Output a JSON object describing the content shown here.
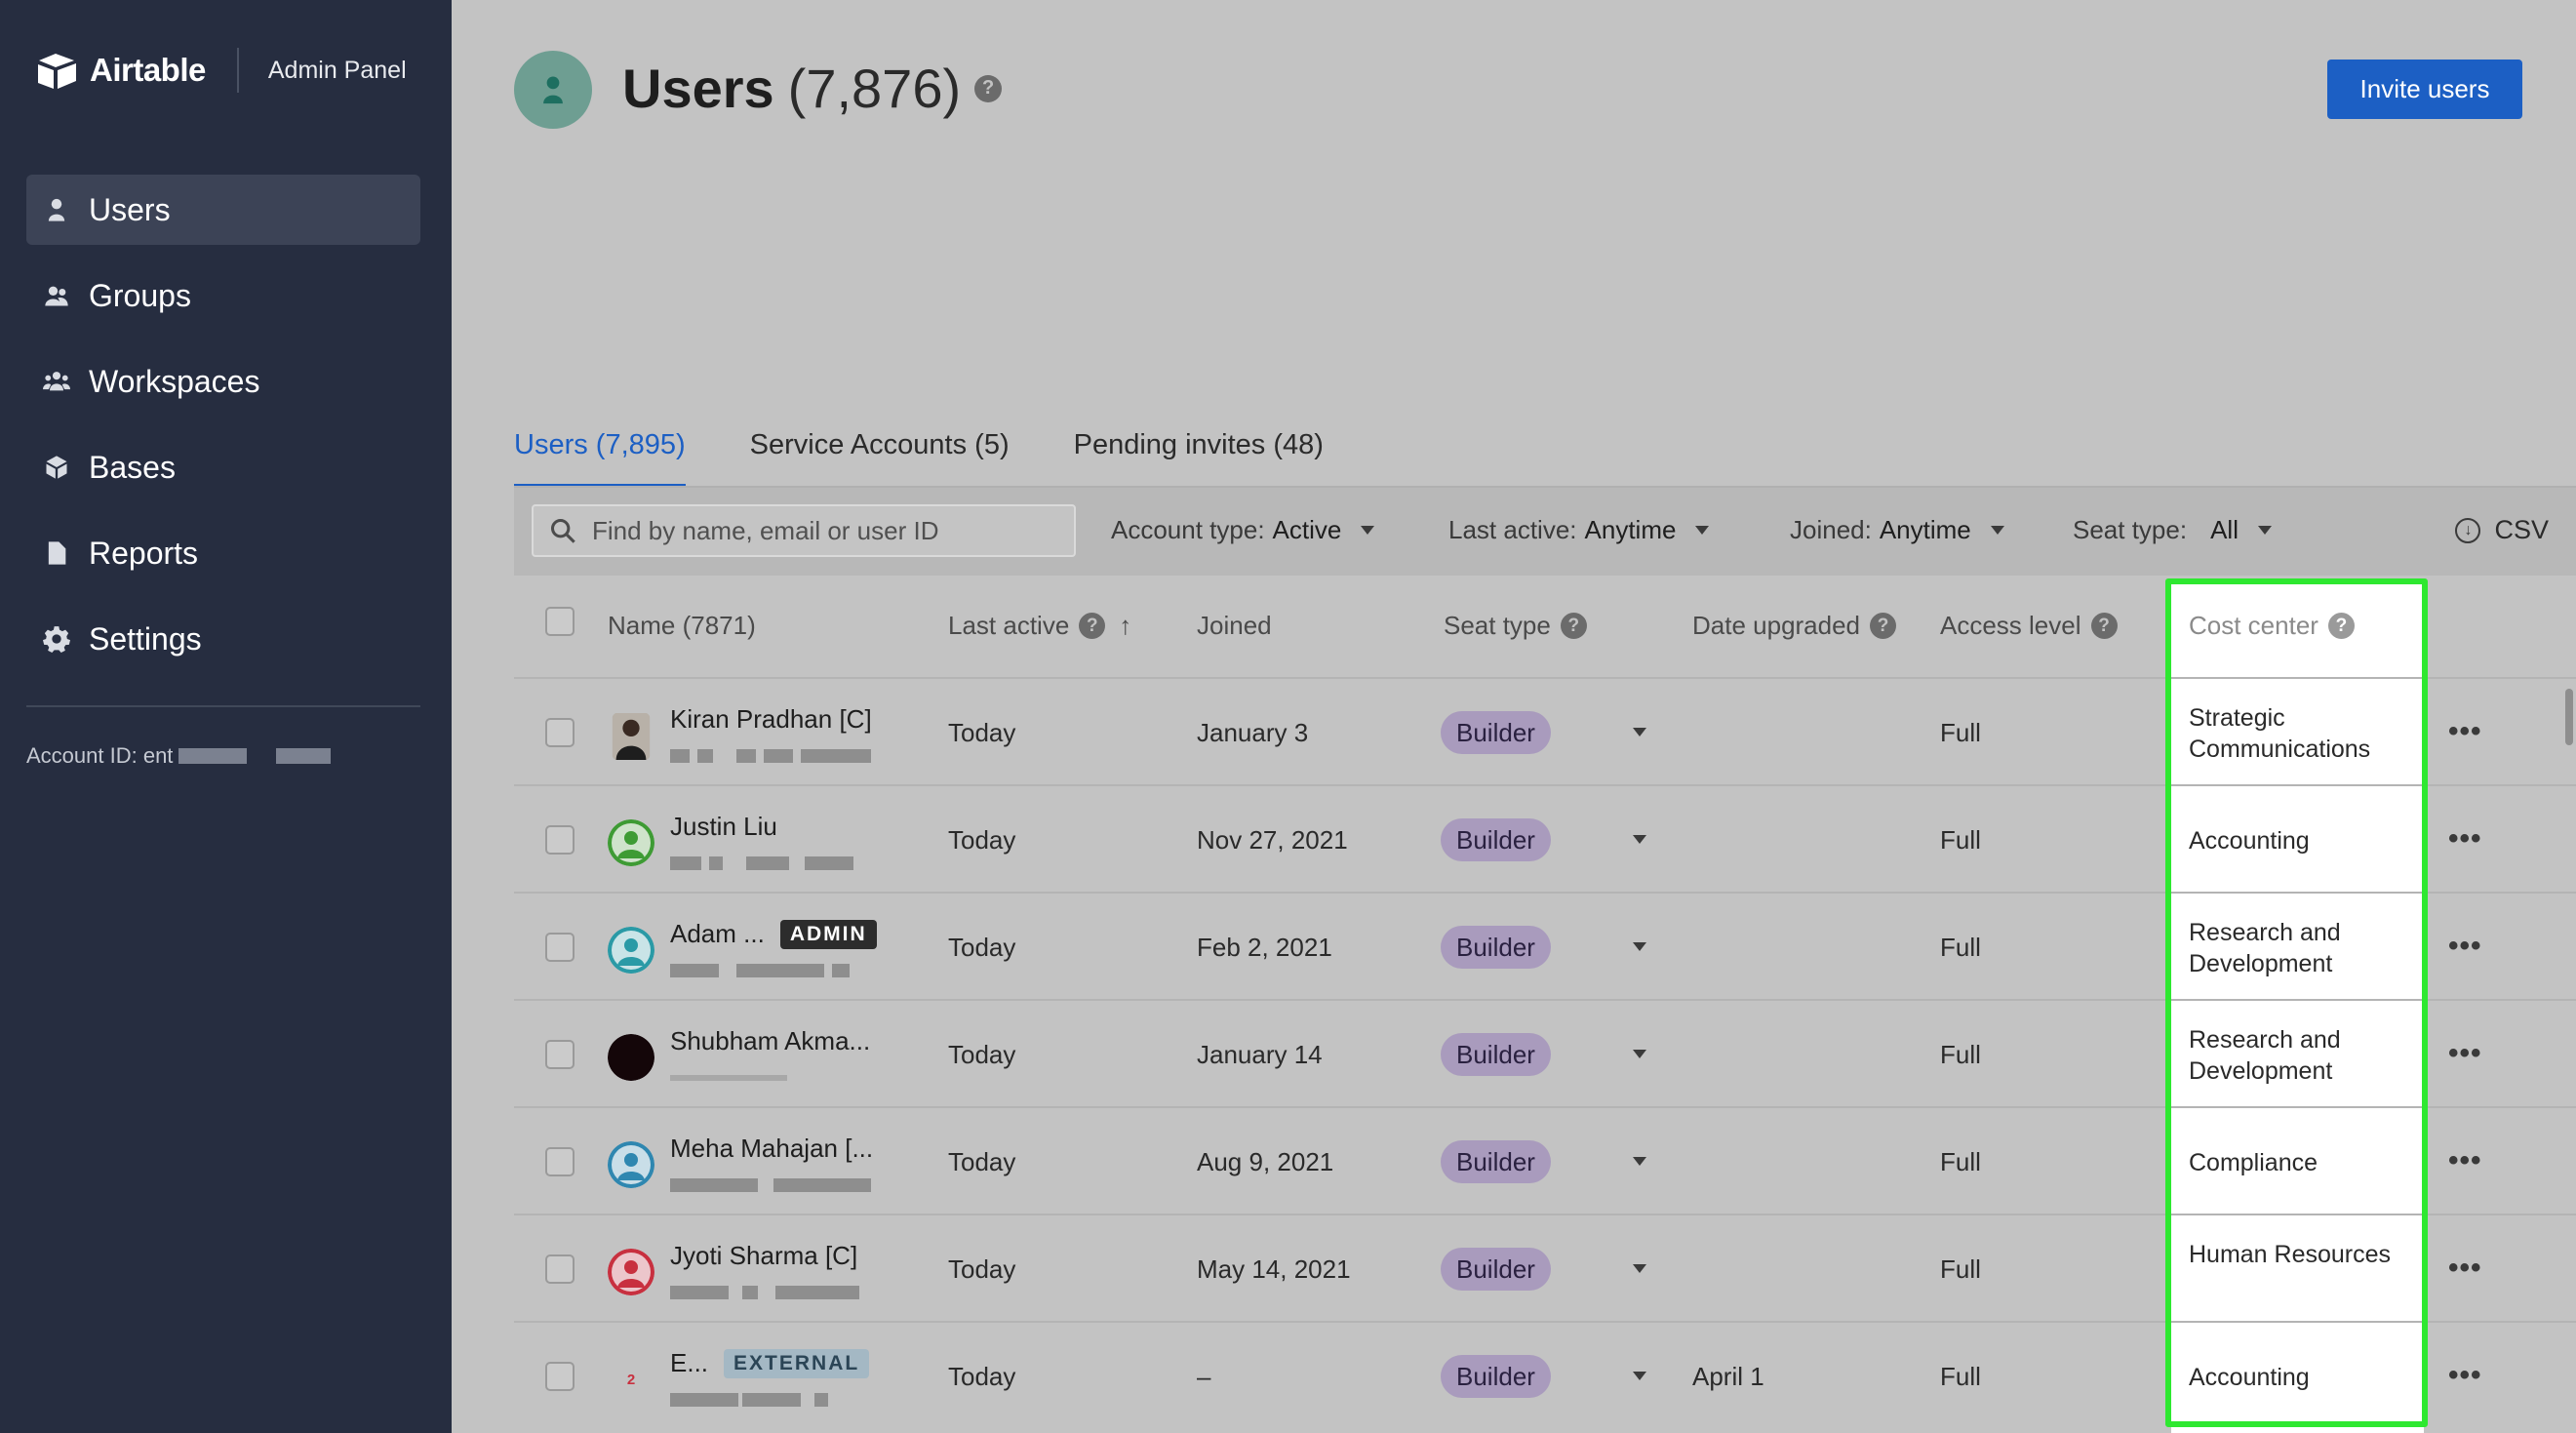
{
  "sidebar": {
    "brand": "Airtable",
    "panel": "Admin Panel",
    "items": [
      {
        "label": "Users",
        "icon": "user-icon",
        "active": true
      },
      {
        "label": "Groups",
        "icon": "group-icon"
      },
      {
        "label": "Workspaces",
        "icon": "workspaces-icon"
      },
      {
        "label": "Bases",
        "icon": "cube-icon"
      },
      {
        "label": "Reports",
        "icon": "document-icon"
      },
      {
        "label": "Settings",
        "icon": "gear-icon"
      }
    ],
    "account_id_label": "Account ID: ent"
  },
  "header": {
    "title": "Users",
    "count": "(7,876)",
    "help": "?",
    "invite_label": "Invite users"
  },
  "tabs": [
    {
      "label": "Users (7,895)",
      "active": true
    },
    {
      "label": "Service Accounts (5)"
    },
    {
      "label": "Pending invites (48)"
    }
  ],
  "filters": {
    "search_placeholder": "Find by name, email or user ID",
    "account_type": {
      "label": "Account type:",
      "value": "Active"
    },
    "last_active": {
      "label": "Last active:",
      "value": "Anytime"
    },
    "joined": {
      "label": "Joined:",
      "value": "Anytime"
    },
    "seat_type": {
      "label": "Seat type:",
      "value": "All"
    },
    "csv_label": "CSV"
  },
  "table": {
    "columns": {
      "name": "Name (7871)",
      "last_active": "Last active",
      "joined": "Joined",
      "seat_type": "Seat type",
      "date_upgraded": "Date upgraded",
      "access_level": "Access level",
      "cost_center": "Cost center"
    },
    "rows": [
      {
        "name": "Kiran Pradhan [C]",
        "last_active": "Today",
        "joined": "January 3",
        "seat": "Builder",
        "date_upgraded": "",
        "access": "Full",
        "cost_center": "Strategic Communications",
        "avatar_color": "#3a2a22"
      },
      {
        "name": "Justin Liu",
        "last_active": "Today",
        "joined": "Nov 27, 2021",
        "seat": "Builder",
        "date_upgraded": "",
        "access": "Full",
        "cost_center": "Accounting",
        "avatar_color": "#3e9b34"
      },
      {
        "name": "Adam ...",
        "badge": "ADMIN",
        "last_active": "Today",
        "joined": "Feb 2, 2021",
        "seat": "Builder",
        "date_upgraded": "",
        "access": "Full",
        "cost_center": "Research and Development",
        "avatar_color": "#2a9aa6"
      },
      {
        "name": "Shubham Akma...",
        "last_active": "Today",
        "joined": "January 14",
        "seat": "Builder",
        "date_upgraded": "",
        "access": "Full",
        "cost_center": "Research and Development",
        "avatar_color": "#140609"
      },
      {
        "name": "Meha Mahajan [...",
        "last_active": "Today",
        "joined": "Aug 9, 2021",
        "seat": "Builder",
        "date_upgraded": "",
        "access": "Full",
        "cost_center": "Compliance",
        "avatar_color": "#2f87b0"
      },
      {
        "name": "Jyoti Sharma [C]",
        "last_active": "Today",
        "joined": "May 14, 2021",
        "seat": "Builder",
        "date_upgraded": "",
        "access": "Full",
        "cost_center": "Human Resources",
        "avatar_color": "#c8303f"
      },
      {
        "name": "E...",
        "badge": "EXTERNAL",
        "avatar_text": "2",
        "last_active": "Today",
        "joined": "–",
        "seat": "Builder",
        "date_upgraded": "April 1",
        "access": "Full",
        "cost_center": "Accounting",
        "avatar_color": "#c3c3c3"
      }
    ],
    "more_label": "•••"
  },
  "colors": {
    "sidebar_bg": "#262d40",
    "accent_blue": "#1c5fc4",
    "highlight_green": "#2ee830",
    "seat_pill": "#a99bbd"
  }
}
